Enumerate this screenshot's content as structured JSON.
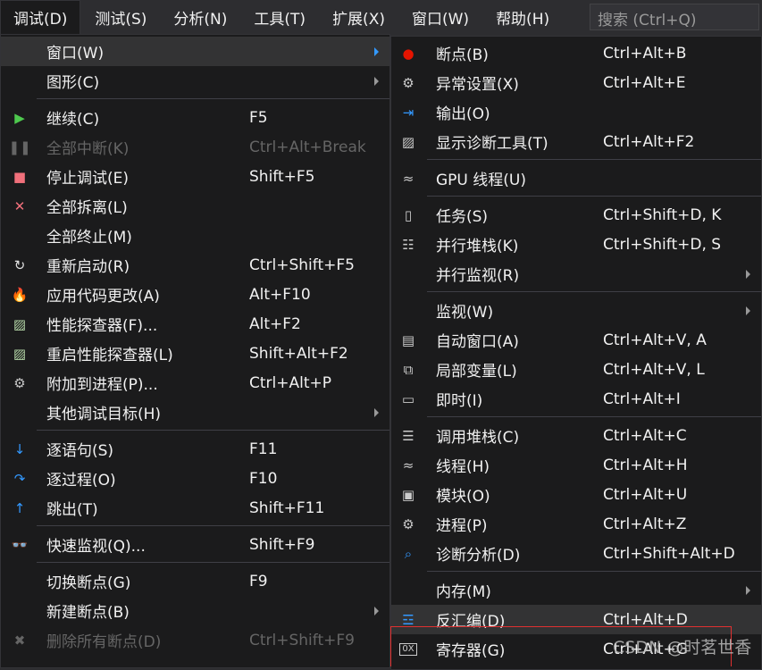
{
  "menubar": {
    "items": [
      "调试(D)",
      "测试(S)",
      "分析(N)",
      "工具(T)",
      "扩展(X)",
      "窗口(W)",
      "帮助(H)"
    ],
    "search_placeholder": "搜索 (Ctrl+Q)"
  },
  "left": [
    {
      "t": "item",
      "icon": "window-icon",
      "label": "窗口(W)",
      "sub": true,
      "hl": true
    },
    {
      "t": "item",
      "icon": "",
      "label": "图形(C)",
      "sub": true
    },
    {
      "t": "sep"
    },
    {
      "t": "item",
      "icon": "play-icon",
      "label": "继续(C)",
      "sc": "F5"
    },
    {
      "t": "item",
      "icon": "pause-icon",
      "label": "全部中断(K)",
      "sc": "Ctrl+Alt+Break",
      "dis": true
    },
    {
      "t": "item",
      "icon": "stop-icon",
      "label": "停止调试(E)",
      "sc": "Shift+F5"
    },
    {
      "t": "item",
      "icon": "close-icon",
      "label": "全部拆离(L)"
    },
    {
      "t": "item",
      "icon": "",
      "label": "全部终止(M)"
    },
    {
      "t": "item",
      "icon": "restart-icon",
      "label": "重新启动(R)",
      "sc": "Ctrl+Shift+F5"
    },
    {
      "t": "item",
      "icon": "flame-icon",
      "label": "应用代码更改(A)",
      "sc": "Alt+F10"
    },
    {
      "t": "item",
      "icon": "chart-icon",
      "label": "性能探查器(F)...",
      "sc": "Alt+F2"
    },
    {
      "t": "item",
      "icon": "chart-icon",
      "label": "重启性能探查器(L)",
      "sc": "Shift+Alt+F2"
    },
    {
      "t": "item",
      "icon": "gears-icon",
      "label": "附加到进程(P)...",
      "sc": "Ctrl+Alt+P"
    },
    {
      "t": "item",
      "icon": "",
      "label": "其他调试目标(H)",
      "sub": true
    },
    {
      "t": "sep"
    },
    {
      "t": "item",
      "icon": "step-into-icon",
      "label": "逐语句(S)",
      "sc": "F11"
    },
    {
      "t": "item",
      "icon": "step-over-icon",
      "label": "逐过程(O)",
      "sc": "F10"
    },
    {
      "t": "item",
      "icon": "step-out-icon",
      "label": "跳出(T)",
      "sc": "Shift+F11"
    },
    {
      "t": "sep"
    },
    {
      "t": "item",
      "icon": "glasses-icon",
      "label": "快速监视(Q)...",
      "sc": "Shift+F9"
    },
    {
      "t": "sep"
    },
    {
      "t": "item",
      "icon": "",
      "label": "切换断点(G)",
      "sc": "F9"
    },
    {
      "t": "item",
      "icon": "",
      "label": "新建断点(B)",
      "sub": true
    },
    {
      "t": "item",
      "icon": "delete-breakpoints-icon",
      "label": "删除所有断点(D)",
      "sc": "Ctrl+Shift+F9",
      "dis": true
    }
  ],
  "right": [
    {
      "t": "item",
      "icon": "breakpoint-icon",
      "label": "断点(B)",
      "sc": "Ctrl+Alt+B"
    },
    {
      "t": "item",
      "icon": "exception-settings-icon",
      "label": "异常设置(X)",
      "sc": "Ctrl+Alt+E"
    },
    {
      "t": "item",
      "icon": "output-icon",
      "label": "输出(O)"
    },
    {
      "t": "item",
      "icon": "diagnostics-icon",
      "label": "显示诊断工具(T)",
      "sc": "Ctrl+Alt+F2"
    },
    {
      "t": "sep"
    },
    {
      "t": "item",
      "icon": "threads-icon",
      "label": "GPU 线程(U)"
    },
    {
      "t": "sep"
    },
    {
      "t": "item",
      "icon": "clipboard-icon",
      "label": "任务(S)",
      "sc": "Ctrl+Shift+D, K"
    },
    {
      "t": "item",
      "icon": "parallel-stacks-icon",
      "label": "并行堆栈(K)",
      "sc": "Ctrl+Shift+D, S"
    },
    {
      "t": "item",
      "icon": "",
      "label": "并行监视(R)",
      "sub": true
    },
    {
      "t": "sep"
    },
    {
      "t": "item",
      "icon": "",
      "label": "监视(W)",
      "sub": true
    },
    {
      "t": "item",
      "icon": "autos-icon",
      "label": "自动窗口(A)",
      "sc": "Ctrl+Alt+V, A"
    },
    {
      "t": "item",
      "icon": "locals-icon",
      "label": "局部变量(L)",
      "sc": "Ctrl+Alt+V, L"
    },
    {
      "t": "item",
      "icon": "immediate-icon",
      "label": "即时(I)",
      "sc": "Ctrl+Alt+I"
    },
    {
      "t": "sep"
    },
    {
      "t": "item",
      "icon": "call-stack-icon",
      "label": "调用堆栈(C)",
      "sc": "Ctrl+Alt+C"
    },
    {
      "t": "item",
      "icon": "threads-icon",
      "label": "线程(H)",
      "sc": "Ctrl+Alt+H"
    },
    {
      "t": "item",
      "icon": "modules-icon",
      "label": "模块(O)",
      "sc": "Ctrl+Alt+U"
    },
    {
      "t": "item",
      "icon": "gears-icon",
      "label": "进程(P)",
      "sc": "Ctrl+Alt+Z"
    },
    {
      "t": "item",
      "icon": "diagnostic-analysis-icon",
      "label": "诊断分析(D)",
      "sc": "Ctrl+Shift+Alt+D"
    },
    {
      "t": "sep"
    },
    {
      "t": "item",
      "icon": "",
      "label": "内存(M)",
      "sub": true
    },
    {
      "t": "item",
      "icon": "disassembly-icon",
      "label": "反汇编(D)",
      "sc": "Ctrl+Alt+D",
      "hl": true
    },
    {
      "t": "item",
      "icon": "registers-icon",
      "label": "寄存器(G)",
      "sc": "Ctrl+Alt+G"
    }
  ],
  "watermark": "CSDN @时茗世香",
  "colors": {
    "menu_bg": "#1b1b1c",
    "highlight": "#333334",
    "accent": "#3399ff",
    "breakpoint": "#e51400"
  }
}
